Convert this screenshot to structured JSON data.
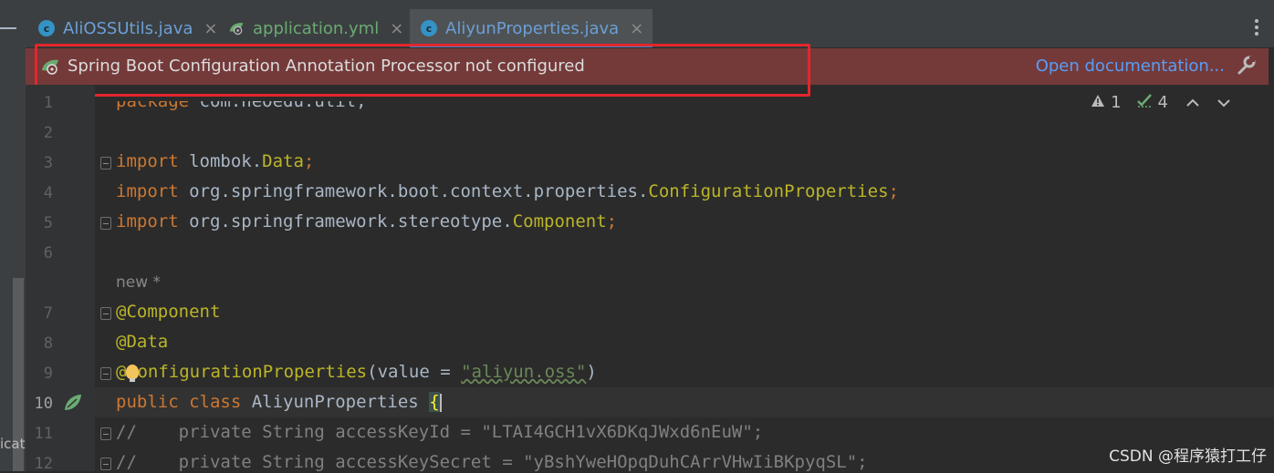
{
  "tabs": [
    {
      "label": "AliOSSUtils.java",
      "icon": "java-class-icon",
      "active": false
    },
    {
      "label": "application.yml",
      "icon": "spring-yml-icon",
      "active": false
    },
    {
      "label": "AliyunProperties.java",
      "icon": "java-class-icon",
      "active": true
    }
  ],
  "tab_close_glyph": "×",
  "class_icon_letter": "c",
  "banner": {
    "message": "Spring Boot Configuration Annotation Processor not configured",
    "link": "Open documentation...",
    "color": "#743a3a"
  },
  "inspections": {
    "warnings": "1",
    "weak_warnings": "4"
  },
  "editor": {
    "line_numbers": [
      "1",
      "2",
      "3",
      "4",
      "5",
      "6",
      "7",
      "8",
      "9",
      "10",
      "11",
      "12"
    ],
    "usage_hint": "new *",
    "lines": {
      "l1_kw": "package",
      "l1_rest": " com.neOedu.util;",
      "l3_kw": "import",
      "l3_pkg": " lombok.",
      "l3_cls": "Data",
      "l3_end": ";",
      "l4_kw": "import",
      "l4_pkg": " org.springframework.boot.context.properties.",
      "l4_cls": "ConfigurationProperties",
      "l4_end": ";",
      "l5_kw": "import",
      "l5_pkg": " org.springframework.stereotype.",
      "l5_cls": "Component",
      "l5_end": ";",
      "l7_ann": "@Component",
      "l8_ann": "@Data",
      "l9_ann_a": "@",
      "l9_ann_b": "onfigurationProperties",
      "l9_paren": "(value = ",
      "l9_str": "\"aliyun.oss\"",
      "l9_close": ")",
      "l10_kw": "public class",
      "l10_name": " AliyunProperties ",
      "l10_brace": "{",
      "l11": "//    private String accessKeyId = \"LTAI4GCH1vX6DKqJWxd6nEuW\";",
      "l12": "//    private String accessKeySecret = \"yBshYweHOpqDuhCArrVHwIiBKpyqSL\";"
    }
  },
  "left_cut_label": "icat",
  "watermark": "CSDN @程序猿打工仔"
}
